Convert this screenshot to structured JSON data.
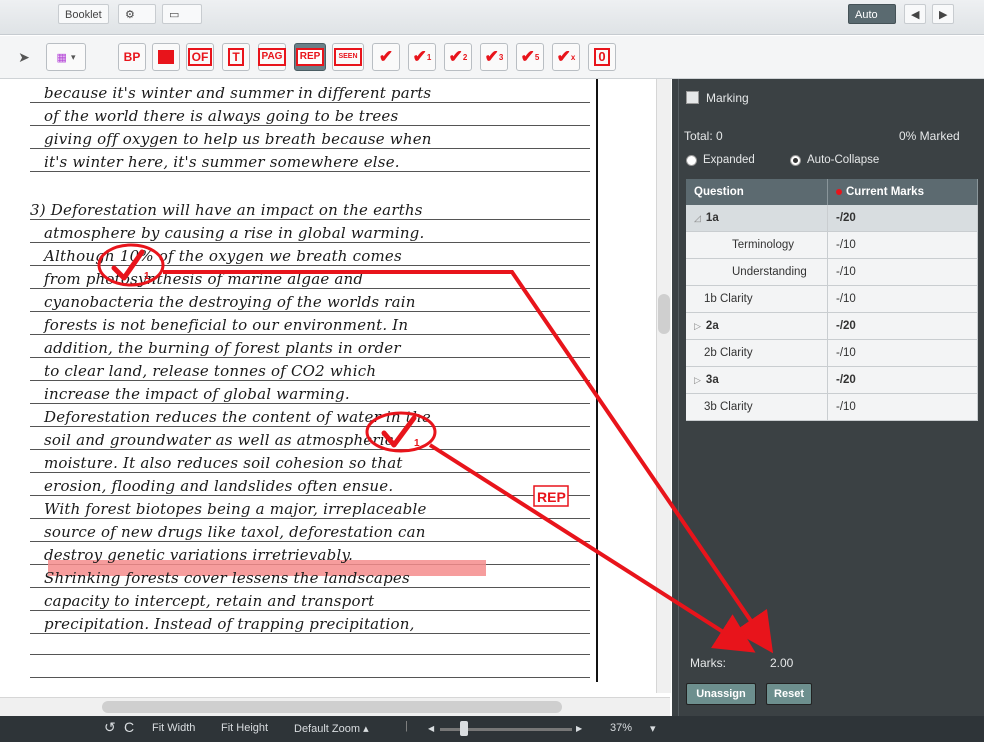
{
  "topbar": {
    "items": [
      "Booklet",
      "Auto"
    ]
  },
  "annotations": {
    "bp": "BP",
    "of": "OF",
    "t": "T",
    "pag": "PAG",
    "rep": "REP",
    "seen": "SEEN",
    "tick1": "1",
    "tick2": "2",
    "tick3": "3",
    "tick5": "5",
    "tick_x": "x",
    "zero": "0"
  },
  "document": {
    "lines": [
      "because it's winter and summer in different parts",
      "of the world there is always going to be trees",
      "giving off oxygen to help us breath because when",
      "it's winter here, it's summer somewhere else.",
      "3) Deforestation will have an impact on the earths",
      "atmosphere by causing a rise in global warming.",
      "Although 10% of the oxygen we breath comes",
      "from photosynthesis of marine algae and",
      "cyanobacteria the destroying of the worlds rain",
      "forests is not beneficial to our environment. In",
      "addition, the burning of forest plants in order",
      "to clear land, release tonnes of CO2 which",
      "increase the impact of global warming.",
      "Deforestation reduces the content of water in the",
      "soil and groundwater as well as atmospheric",
      "moisture. It also reduces soil cohesion so that",
      "erosion, flooding and landslides often ensue.",
      "With forest biotopes being a major, irreplaceable",
      "source of new drugs like taxol, deforestation can",
      "destroy genetic variations irretrievably.",
      "Shrinking forests cover lessens the landscapes",
      "capacity to intercept, retain and transport",
      "precipitation. Instead of trapping precipitation,"
    ],
    "stamp_rep": "REP",
    "tick_label": "1"
  },
  "panel": {
    "title": "Marking",
    "total_label": "Total: 0",
    "percent_label": "0% Marked",
    "mode_expanded": "Expanded",
    "mode_autocollapse": "Auto-Collapse",
    "table_headers": [
      "Question",
      "Current Marks"
    ],
    "rows": [
      {
        "q": "1a",
        "m": "-/20",
        "bold": true,
        "expander": "◿",
        "indent": 0,
        "sel": true
      },
      {
        "q": "Terminology",
        "m": "-/10",
        "bold": false,
        "expander": "",
        "indent": 2,
        "sel": false
      },
      {
        "q": "Understanding",
        "m": "-/10",
        "bold": false,
        "expander": "",
        "indent": 2,
        "sel": false
      },
      {
        "q": "1b Clarity",
        "m": "-/10",
        "bold": false,
        "expander": "",
        "indent": 1,
        "sel": false
      },
      {
        "q": "2a",
        "m": "-/20",
        "bold": true,
        "expander": "▷",
        "indent": 0,
        "sel": false
      },
      {
        "q": "2b Clarity",
        "m": "-/10",
        "bold": false,
        "expander": "",
        "indent": 1,
        "sel": false
      },
      {
        "q": "3a",
        "m": "-/20",
        "bold": true,
        "expander": "▷",
        "indent": 0,
        "sel": false
      },
      {
        "q": "3b Clarity",
        "m": "-/10",
        "bold": false,
        "expander": "",
        "indent": 1,
        "sel": false
      }
    ],
    "marks_label": "Marks:",
    "marks_value": "2.00",
    "unassign": "Unassign",
    "reset": "Reset"
  },
  "bottombar": {
    "rotate_ccw": "↺",
    "rotate_cw": "C",
    "fit_width": "Fit Width",
    "fit_height": "Fit Height",
    "default_zoom": "Default Zoom ▴",
    "zoom_value": "37%",
    "zoom_dropdown": "▾"
  },
  "colors": {
    "annotation_red": "#e8141b",
    "panel_bg": "#3b4144",
    "button_teal": "#6d8f8e",
    "highlight": "#f48c8c"
  }
}
